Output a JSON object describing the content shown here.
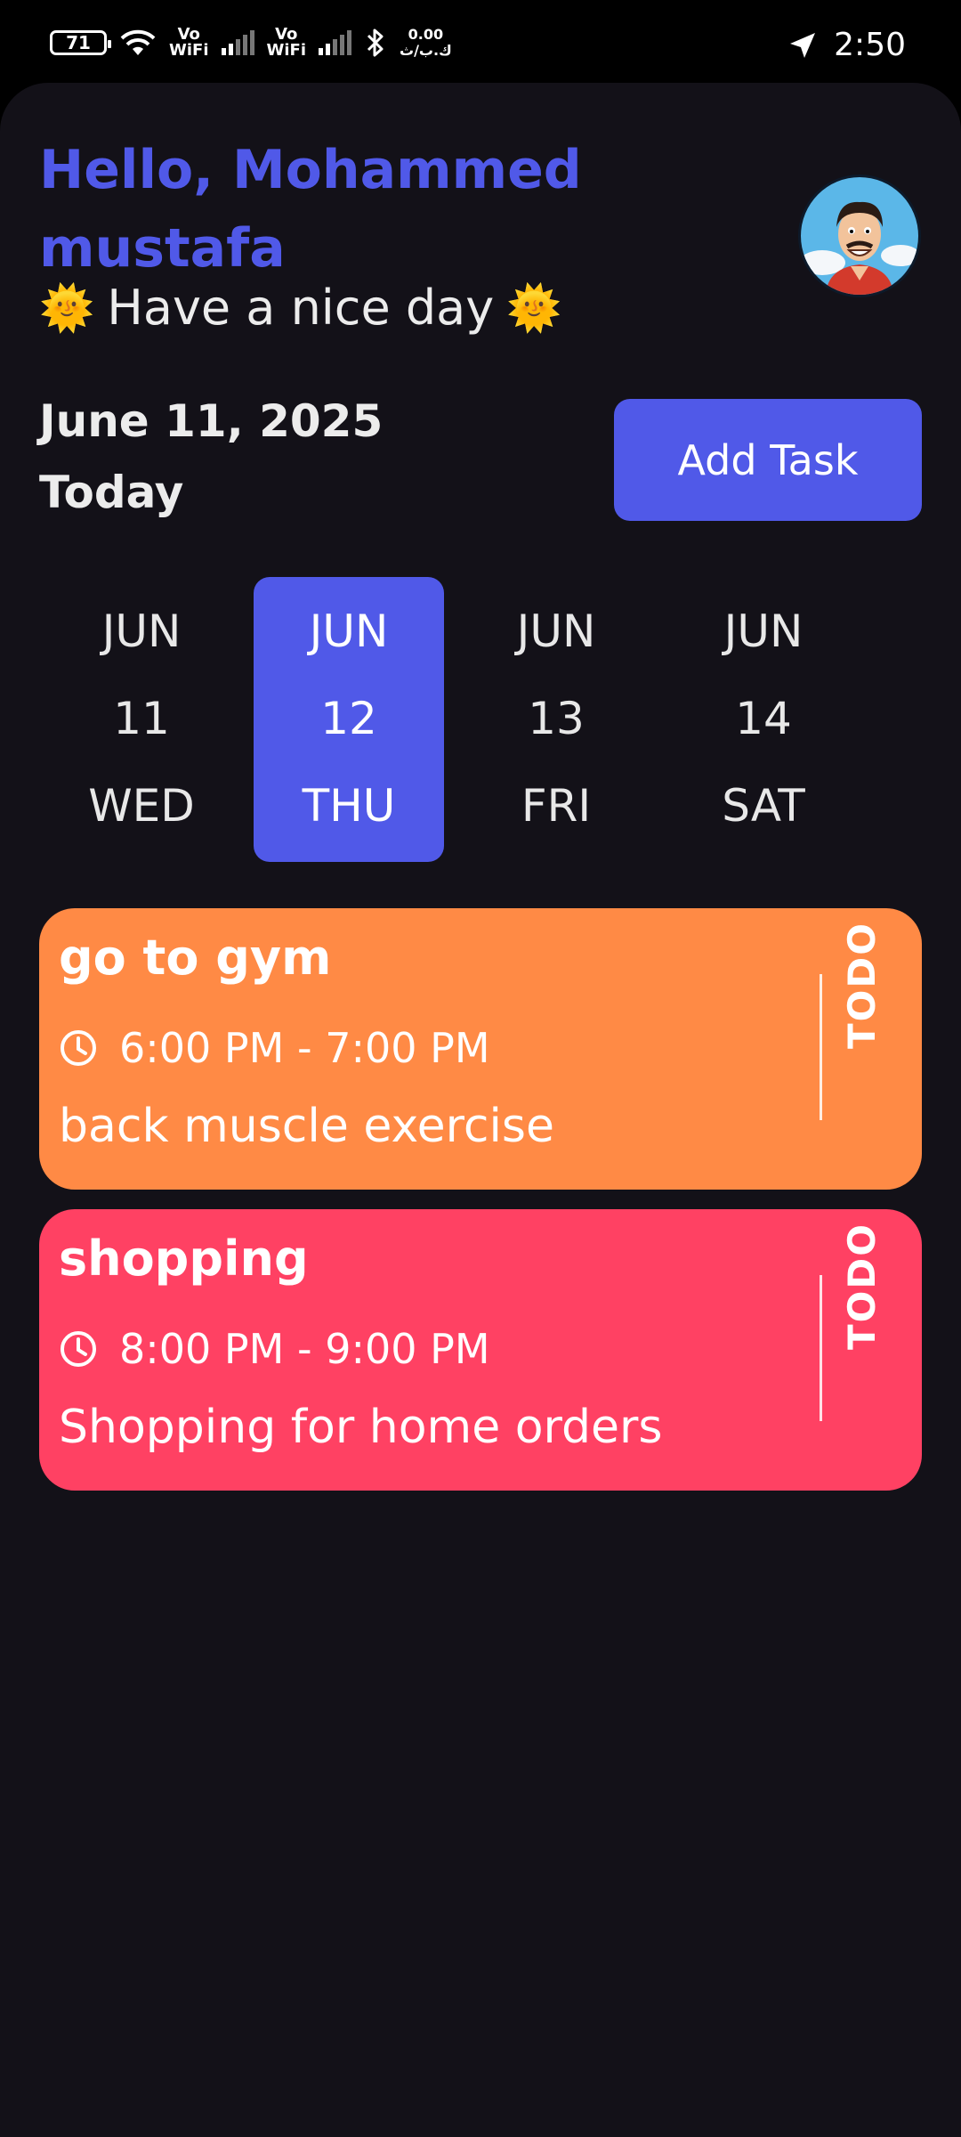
{
  "status_bar": {
    "battery": "71",
    "vowifi_1": "Vo\nWiFi",
    "vowifi_2": "Vo\nWiFi",
    "net_speed_value": "0.00",
    "net_speed_unit": "ك.ب/ث",
    "time": "2:50"
  },
  "header": {
    "greeting_line1": "Hello, Mohammed",
    "greeting_line2": "mustafa",
    "subtitle": "Have a nice day",
    "emoji_left": "🌞",
    "emoji_right": "🌞",
    "avatar": "cartoon-man-avatar"
  },
  "date_section": {
    "date": "June 11, 2025",
    "label": "Today",
    "add_task_label": "Add Task"
  },
  "calendar": [
    {
      "month": "JUN",
      "day": "11",
      "weekday": "WED",
      "selected": false
    },
    {
      "month": "JUN",
      "day": "12",
      "weekday": "THU",
      "selected": true
    },
    {
      "month": "JUN",
      "day": "13",
      "weekday": "FRI",
      "selected": false
    },
    {
      "month": "JUN",
      "day": "14",
      "weekday": "SAT",
      "selected": false
    }
  ],
  "tasks": [
    {
      "title": "go to gym",
      "time": "6:00 PM - 7:00 PM",
      "description": "back muscle exercise",
      "status": "TODO",
      "color": "#FF8A45"
    },
    {
      "title": "shopping",
      "time": "8:00 PM - 9:00 PM",
      "description": "Shopping for home orders",
      "status": "TODO",
      "color": "#FF4163"
    }
  ],
  "colors": {
    "accent": "#5059E8",
    "background": "#131118",
    "text": "#ECECEC"
  }
}
